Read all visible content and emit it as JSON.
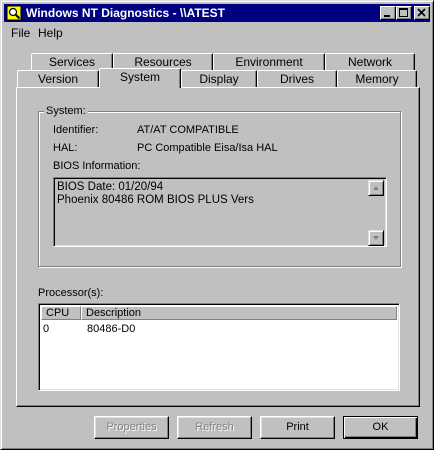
{
  "window": {
    "title": "Windows NT Diagnostics - \\\\ATEST"
  },
  "menubar": {
    "items": [
      {
        "label": "File"
      },
      {
        "label": "Help"
      }
    ]
  },
  "tabs": {
    "row_back": [
      "Services",
      "Resources",
      "Environment",
      "Network"
    ],
    "row_front": [
      "Version",
      "System",
      "Display",
      "Drives",
      "Memory"
    ],
    "active": "System"
  },
  "system": {
    "group_label": "System:",
    "identifier_label": "Identifier:",
    "identifier_value": "AT/AT COMPATIBLE",
    "hal_label": "HAL:",
    "hal_value": "PC Compatible Eisa/Isa HAL",
    "bios_label": "BIOS Information:",
    "bios_lines": [
      "BIOS Date: 01/20/94",
      "Phoenix 80486 ROM BIOS PLUS Vers"
    ]
  },
  "processors": {
    "label": "Processor(s):",
    "columns": [
      "CPU",
      "Description"
    ],
    "rows": [
      {
        "cpu": "0",
        "description": "80486-D0"
      }
    ]
  },
  "buttons": {
    "properties": "Properties",
    "refresh": "Refresh",
    "print": "Print",
    "ok": "OK"
  }
}
